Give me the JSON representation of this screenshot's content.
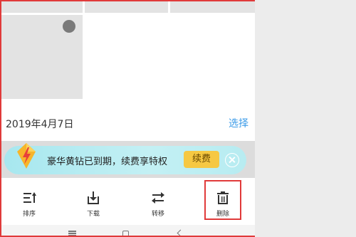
{
  "gallery": {
    "date_label": "2019年4月7日",
    "select_link": "选择"
  },
  "banner": {
    "text": "豪华黄钻已到期，续费享特权",
    "renew_label": "续费",
    "icon": "yellow-diamond-icon"
  },
  "toolbar": {
    "items": [
      {
        "label": "排序",
        "icon": "sort-icon"
      },
      {
        "label": "下载",
        "icon": "download-icon"
      },
      {
        "label": "转移",
        "icon": "transfer-icon"
      },
      {
        "label": "删除",
        "icon": "trash-icon"
      }
    ]
  },
  "navbar": {
    "icons": [
      "menu-icon",
      "home-icon",
      "back-icon"
    ]
  },
  "colors": {
    "accent": "#3b9be8",
    "annotation": "#e03a3a",
    "renew_button": "#f6c842",
    "banner": "#b7ecf1"
  }
}
